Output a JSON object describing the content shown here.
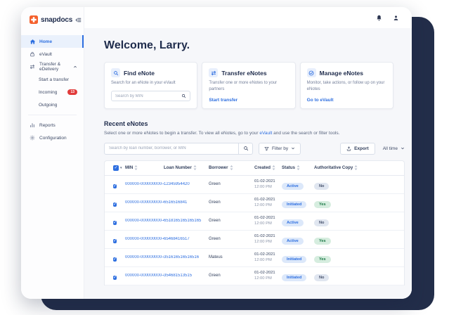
{
  "sidebar": {
    "logo_text": "snapdocs",
    "items": [
      {
        "label": "Home",
        "icon": "home-icon",
        "active": true
      },
      {
        "label": "eVault",
        "icon": "lock-icon"
      },
      {
        "label": "Transfer & eDelivery",
        "icon": "transfer-icon",
        "expanded": true
      },
      {
        "label": "Start a transfer",
        "sub": true
      },
      {
        "label": "Incoming",
        "sub": true,
        "badge": "13"
      },
      {
        "label": "Outgoing",
        "sub": true
      },
      {
        "label": "Reports",
        "icon": "reports-icon"
      },
      {
        "label": "Configuration",
        "icon": "gear-icon"
      }
    ]
  },
  "topbar": {
    "icons": [
      "bell-icon",
      "user-icon"
    ]
  },
  "header": {
    "greeting": "Welcome, Larry."
  },
  "cards": [
    {
      "title": "Find eNote",
      "icon": "search-circle-icon",
      "description": "Search for an eNote in your eVault",
      "input_placeholder": "Search by MIN"
    },
    {
      "title": "Transfer eNotes",
      "icon": "transfer-circle-icon",
      "description": "Transfer one or more eNotes to your partners",
      "link": "Start transfer"
    },
    {
      "title": "Manage eNotes",
      "icon": "manage-circle-icon",
      "description": "Monitor, take actions, or follow up on your eNotes",
      "link": "Go to eVault"
    }
  ],
  "recent": {
    "title": "Recent eNotes",
    "subtitle_before": "Select one or more eNotes to begin a transfer.  To view all eNotes, go to your ",
    "subtitle_link": "eVault",
    "subtitle_after": " and use the search or filter tools.",
    "search_placeholder": "Search by loan number, borrower, or MIN",
    "filter_label": "Filter by",
    "export_label": "Export",
    "time_range_label": "All time"
  },
  "table": {
    "columns": [
      "MIN",
      "Loan Number",
      "Borrower",
      "Created",
      "Status",
      "Authoritative Copy"
    ],
    "rows": [
      {
        "checked": true,
        "min": "000000-000000000-4",
        "loan_number": "12345954420",
        "borrower": "Green",
        "created_date": "01-02-2021",
        "created_time": "12:00 PM",
        "status": "Active",
        "authoritative_copy": "No"
      },
      {
        "checked": true,
        "min": "000000-000000000-4",
        "loan_number": "6516516841",
        "borrower": "Green",
        "created_date": "01-02-2021",
        "created_time": "12:00 PM",
        "status": "Initiated",
        "authoritative_copy": "Yes"
      },
      {
        "checked": true,
        "min": "000000-000000000-4",
        "loan_number": "6518165165165165",
        "borrower": "Green",
        "created_date": "01-02-2021",
        "created_time": "12:00 PM",
        "status": "Active",
        "authoritative_copy": "No"
      },
      {
        "checked": true,
        "min": "000000-000000000-4",
        "loan_number": "65468416517",
        "borrower": "Green",
        "created_date": "01-02-2021",
        "created_time": "12:00 PM",
        "status": "Active",
        "authoritative_copy": "Yes"
      },
      {
        "checked": true,
        "min": "000000-000000000-4",
        "loan_number": "351616516516516",
        "borrower": "Mateus",
        "created_date": "01-02-2021",
        "created_time": "12:00 PM",
        "status": "Initiated",
        "authoritative_copy": "Yes"
      },
      {
        "checked": true,
        "min": "000000-000000000-4",
        "loan_number": "354681513515",
        "borrower": "Green",
        "created_date": "01-02-2021",
        "created_time": "12:00 PM",
        "status": "Initiated",
        "authoritative_copy": "No"
      }
    ]
  },
  "colors": {
    "brand_orange": "#f4602c",
    "accent_blue": "#2e6fe0",
    "navy_text": "#1f2c4c",
    "backdrop_navy": "#232e4a",
    "badge_red": "#e13b3b",
    "pill_blue_bg": "#dce8fa",
    "pill_green_bg": "#d6eddf",
    "pill_green_text": "#1d7a48",
    "pill_gray_bg": "#e0e6f0"
  }
}
